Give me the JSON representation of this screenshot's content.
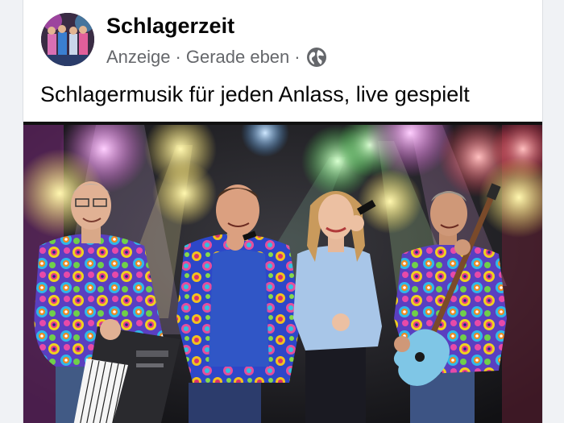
{
  "post": {
    "page_name": "Schlagerzeit",
    "sponsored_label": "Anzeige",
    "separator": "·",
    "timestamp": "Gerade eben",
    "audience_icon": "globe-icon",
    "caption": "Schlagermusik für jeden Anlass, live gespielt"
  },
  "colors": {
    "name_text": "#050505",
    "meta_text": "#65676b",
    "card_background": "#ffffff"
  }
}
